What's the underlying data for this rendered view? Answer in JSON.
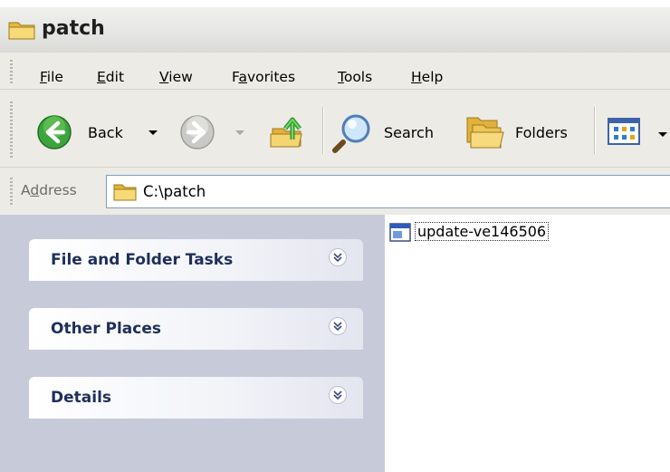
{
  "window": {
    "title": "patch"
  },
  "menu": {
    "items": [
      {
        "key": "F",
        "rest": "ile"
      },
      {
        "key": "E",
        "rest": "dit"
      },
      {
        "key": "V",
        "rest": "iew"
      },
      {
        "pre": "F",
        "key": "a",
        "rest": "vorites"
      },
      {
        "key": "T",
        "rest": "ools"
      },
      {
        "key": "H",
        "rest": "elp"
      }
    ]
  },
  "toolbar": {
    "back_label": "Back",
    "search_label": "Search",
    "folders_label": "Folders"
  },
  "address": {
    "label_pre": "A",
    "label_key": "d",
    "label_rest": "dress",
    "path": "C:\\patch"
  },
  "task_pane": {
    "groups": [
      {
        "title": "File and Folder Tasks"
      },
      {
        "title": "Other Places"
      },
      {
        "title": "Details"
      }
    ]
  },
  "files": [
    {
      "name": "update-ve146506"
    }
  ],
  "colors": {
    "accent_blue": "#1f2f5a",
    "back_green": "#2e9b2e",
    "folder_yellow": "#f4d26b"
  }
}
